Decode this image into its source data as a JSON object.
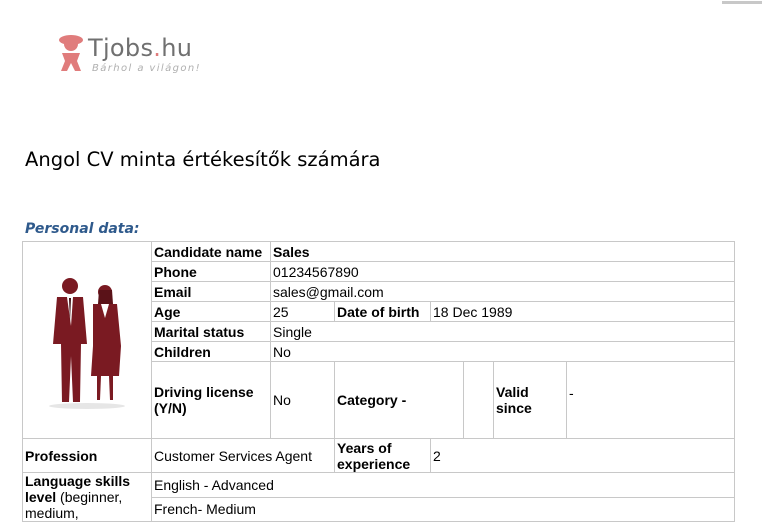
{
  "logo": {
    "brand_main": "Tjobs",
    "brand_dot": ".",
    "brand_tld": "hu",
    "tagline": "Bárhol a világon!"
  },
  "document": {
    "title": "Angol CV minta értékesítők számára"
  },
  "personal_section": {
    "heading": "Personal data:",
    "candidate_name_label": "Candidate name",
    "candidate_name_value": "Sales",
    "phone_label": "Phone",
    "phone_value": "01234567890",
    "email_label": "Email",
    "email_value": "sales@gmail.com",
    "age_label": "Age",
    "age_value": "25",
    "dob_label": "Date of birth",
    "dob_value": "18 Dec 1989",
    "marital_label": "Marital status",
    "marital_value": "Single",
    "children_label": "Children",
    "children_value": "No",
    "driving_label": "Driving license (Y/N)",
    "driving_value": "No",
    "category_label": "Category -",
    "category_value": "",
    "valid_label": "Valid since",
    "valid_value": "-",
    "profession_label": "Profession",
    "profession_value": "Customer Services Agent",
    "years_label": "Years of experience",
    "years_value": "2",
    "language_label_bold": "Language skills level",
    "language_label_rest": " (beginner, medium,",
    "languages": [
      "English - Advanced",
      "French- Medium"
    ]
  },
  "colors": {
    "section_heading": "#2f5a8c",
    "logo_accent": "#e07c7c",
    "silhouette": "#7a1a22"
  }
}
